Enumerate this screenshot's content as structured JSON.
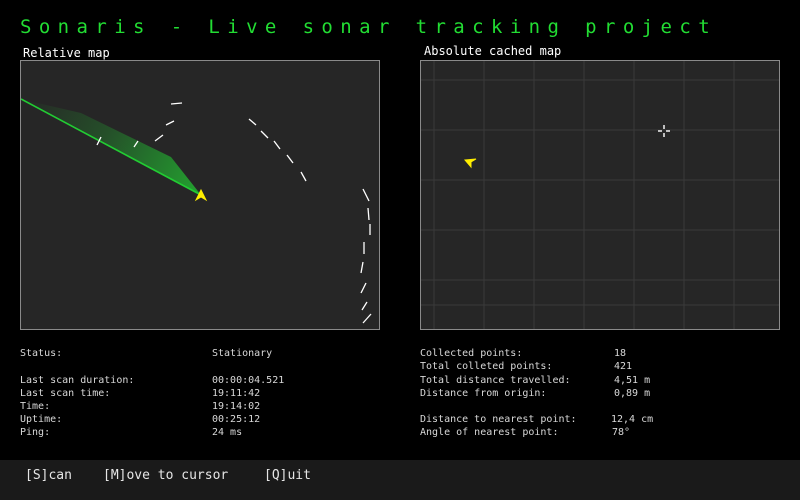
{
  "app": {
    "title": "Sonaris - Live sonar tracking project"
  },
  "colors": {
    "title": "#22dd33",
    "sweep": "#22cc33",
    "marker": "#ffee00",
    "background": "#000000",
    "map_background": "#262626"
  },
  "relative_map": {
    "label": "Relative map"
  },
  "absolute_map": {
    "label": "Absolute cached map"
  },
  "status_left": [
    {
      "label": "Status:",
      "value": "Stationary"
    },
    {
      "label": "Last scan duration:",
      "value": "00:00:04.521"
    },
    {
      "label": "Last scan time:",
      "value": "19:11:42"
    },
    {
      "label": "Time:",
      "value": "19:14:02"
    },
    {
      "label": "Uptime:",
      "value": "00:25:12"
    },
    {
      "label": "Ping:",
      "value": "24 ms"
    }
  ],
  "status_right": [
    {
      "label": "Collected points:",
      "value": "18"
    },
    {
      "label": "Total colleted points:",
      "value": "421"
    },
    {
      "label": "Total distance travelled:",
      "value": "4,51 m"
    },
    {
      "label": "Distance from origin:",
      "value": "0,89 m"
    },
    {
      "label": "Distance to nearest point:",
      "value": "12,4 cm"
    },
    {
      "label": "Angle of nearest point:",
      "value": "78°"
    }
  ],
  "commands": [
    {
      "label": "[S]can"
    },
    {
      "label": "[M]ove to cursor"
    },
    {
      "label": "[Q]uit"
    }
  ],
  "icons": {
    "vehicle": "arrow-marker-icon",
    "cursor": "crosshair-icon"
  }
}
